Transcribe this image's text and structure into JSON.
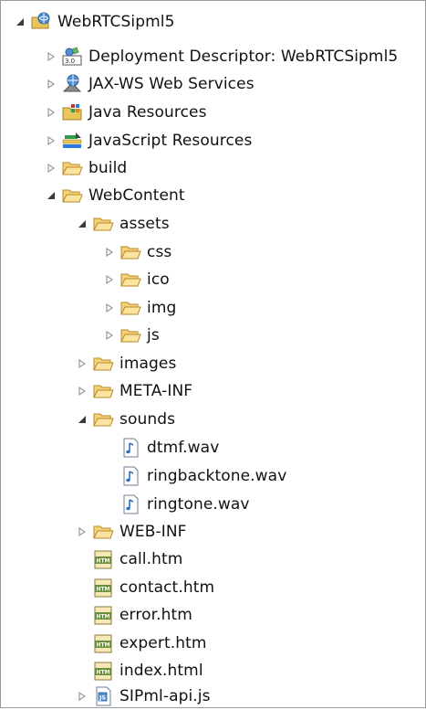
{
  "tree": {
    "root": {
      "label": "WebRTCSipml5",
      "icon": "web-project-icon"
    },
    "items": [
      {
        "label": "Deployment Descriptor: WebRTCSipml5",
        "icon": "deployment-descriptor-icon"
      },
      {
        "label": "JAX-WS Web Services",
        "icon": "web-services-icon"
      },
      {
        "label": "Java Resources",
        "icon": "java-resources-icon"
      },
      {
        "label": "JavaScript Resources",
        "icon": "javascript-resources-icon"
      },
      {
        "label": "build",
        "icon": "folder-icon"
      },
      {
        "label": "WebContent",
        "icon": "folder-icon"
      },
      {
        "label": "assets",
        "icon": "folder-icon"
      },
      {
        "label": "css",
        "icon": "folder-icon"
      },
      {
        "label": "ico",
        "icon": "folder-icon"
      },
      {
        "label": "img",
        "icon": "folder-icon"
      },
      {
        "label": "js",
        "icon": "folder-icon"
      },
      {
        "label": "images",
        "icon": "folder-icon"
      },
      {
        "label": "META-INF",
        "icon": "folder-icon"
      },
      {
        "label": "sounds",
        "icon": "folder-icon"
      },
      {
        "label": "dtmf.wav",
        "icon": "audio-file-icon"
      },
      {
        "label": "ringbacktone.wav",
        "icon": "audio-file-icon"
      },
      {
        "label": "ringtone.wav",
        "icon": "audio-file-icon"
      },
      {
        "label": "WEB-INF",
        "icon": "folder-icon"
      },
      {
        "label": "call.htm",
        "icon": "html-file-icon"
      },
      {
        "label": "contact.htm",
        "icon": "html-file-icon"
      },
      {
        "label": "error.htm",
        "icon": "html-file-icon"
      },
      {
        "label": "expert.htm",
        "icon": "html-file-icon"
      },
      {
        "label": "index.html",
        "icon": "html-file-icon"
      },
      {
        "label": "SIPml-api.js",
        "icon": "js-file-icon"
      }
    ]
  }
}
